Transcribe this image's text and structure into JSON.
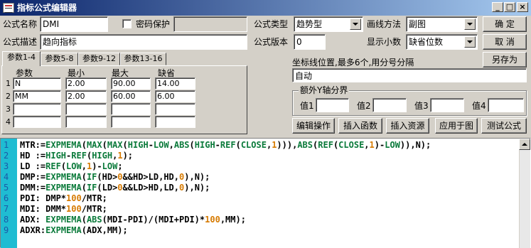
{
  "window": {
    "title": "指标公式编辑器",
    "minimize_label": "_",
    "maximize_label": "□",
    "close_label": "×"
  },
  "form": {
    "name_label": "公式名称",
    "name_value": "DMI",
    "password_label": "密码保护",
    "password_checked": false,
    "password_value": "",
    "type_label": "公式类型",
    "type_value": "趋势型",
    "draw_label": "画线方法",
    "draw_value": "副图",
    "desc_label": "公式描述",
    "desc_value": "趋向指标",
    "version_label": "公式版本",
    "version_value": "0",
    "decimals_label": "显示小数",
    "decimals_value": "缺省位数",
    "ok_label": "确  定",
    "cancel_label": "取  消",
    "saveas_label": "另存为"
  },
  "params": {
    "tabs": [
      "参数1-4",
      "参数5-8",
      "参数9-12",
      "参数13-16"
    ],
    "active_tab": 0,
    "headers": [
      "参数",
      "最小",
      "最大",
      "缺省"
    ],
    "rows": [
      {
        "num": "1",
        "name": "N",
        "min": "2.00",
        "max": "90.00",
        "def": "14.00"
      },
      {
        "num": "2",
        "name": "MM",
        "min": "2.00",
        "max": "60.00",
        "def": "6.00"
      },
      {
        "num": "3",
        "name": "",
        "min": "",
        "max": "",
        "def": ""
      },
      {
        "num": "4",
        "name": "",
        "min": "",
        "max": "",
        "def": ""
      }
    ]
  },
  "axis": {
    "label": "坐标线位置,最多6个,用分号分隔",
    "value": "自动",
    "extra_group_label": "额外Y轴分界",
    "values": [
      {
        "label": "值1",
        "value": ""
      },
      {
        "label": "值2",
        "value": ""
      },
      {
        "label": "值3",
        "value": ""
      },
      {
        "label": "值4",
        "value": ""
      }
    ]
  },
  "actions": {
    "edit": "编辑操作",
    "insert_func": "插入函数",
    "insert_res": "插入资源",
    "apply": "应用于图",
    "test": "测试公式"
  },
  "code_lines": [
    [
      [
        "t",
        "MTR:="
      ],
      [
        "f",
        "EXPMEMA"
      ],
      [
        "t",
        "("
      ],
      [
        "f",
        "MAX"
      ],
      [
        "t",
        "("
      ],
      [
        "f",
        "MAX"
      ],
      [
        "t",
        "("
      ],
      [
        "f",
        "HIGH"
      ],
      [
        "t",
        "-"
      ],
      [
        "f",
        "LOW"
      ],
      [
        "t",
        ","
      ],
      [
        "f",
        "ABS"
      ],
      [
        "t",
        "("
      ],
      [
        "f",
        "HIGH"
      ],
      [
        "t",
        "-"
      ],
      [
        "f",
        "REF"
      ],
      [
        "t",
        "("
      ],
      [
        "f",
        "CLOSE"
      ],
      [
        "t",
        ","
      ],
      [
        "n",
        "1"
      ],
      [
        "t",
        "))),"
      ],
      [
        "f",
        "ABS"
      ],
      [
        "t",
        "("
      ],
      [
        "f",
        "REF"
      ],
      [
        "t",
        "("
      ],
      [
        "f",
        "CLOSE"
      ],
      [
        "t",
        ","
      ],
      [
        "n",
        "1"
      ],
      [
        "t",
        ")-"
      ],
      [
        "f",
        "LOW"
      ],
      [
        "t",
        ")),N);"
      ]
    ],
    [
      [
        "t",
        "HD :="
      ],
      [
        "f",
        "HIGH"
      ],
      [
        "t",
        "-"
      ],
      [
        "f",
        "REF"
      ],
      [
        "t",
        "("
      ],
      [
        "f",
        "HIGH"
      ],
      [
        "t",
        ","
      ],
      [
        "n",
        "1"
      ],
      [
        "t",
        ");"
      ]
    ],
    [
      [
        "t",
        "LD :="
      ],
      [
        "f",
        "REF"
      ],
      [
        "t",
        "("
      ],
      [
        "f",
        "LOW"
      ],
      [
        "t",
        ","
      ],
      [
        "n",
        "1"
      ],
      [
        "t",
        ")-"
      ],
      [
        "f",
        "LOW"
      ],
      [
        "t",
        ";"
      ]
    ],
    [
      [
        "t",
        "DMP:="
      ],
      [
        "f",
        "EXPMEMA"
      ],
      [
        "t",
        "("
      ],
      [
        "f",
        "IF"
      ],
      [
        "t",
        "(HD>"
      ],
      [
        "n",
        "0"
      ],
      [
        "t",
        "&&HD>LD,HD,"
      ],
      [
        "n",
        "0"
      ],
      [
        "t",
        "),N);"
      ]
    ],
    [
      [
        "t",
        "DMM:="
      ],
      [
        "f",
        "EXPMEMA"
      ],
      [
        "t",
        "("
      ],
      [
        "f",
        "IF"
      ],
      [
        "t",
        "(LD>"
      ],
      [
        "n",
        "0"
      ],
      [
        "t",
        "&&LD>HD,LD,"
      ],
      [
        "n",
        "0"
      ],
      [
        "t",
        "),N);"
      ]
    ],
    [
      [
        "t",
        "PDI: DMP*"
      ],
      [
        "n",
        "100"
      ],
      [
        "t",
        "/MTR;"
      ]
    ],
    [
      [
        "t",
        "MDI: DMM*"
      ],
      [
        "n",
        "100"
      ],
      [
        "t",
        "/MTR;"
      ]
    ],
    [
      [
        "t",
        "ADX: "
      ],
      [
        "f",
        "EXPMEMA"
      ],
      [
        "t",
        "("
      ],
      [
        "f",
        "ABS"
      ],
      [
        "t",
        "(MDI-PDI)/(MDI+PDI)*"
      ],
      [
        "n",
        "100"
      ],
      [
        "t",
        ",MM);"
      ]
    ],
    [
      [
        "t",
        "ADXR:"
      ],
      [
        "f",
        "EXPMEMA"
      ],
      [
        "t",
        "(ADX,MM);"
      ]
    ]
  ],
  "colors": {
    "title_bar": "#0a246a",
    "gutter": "#1fbcd2",
    "function": "#0a7a3a",
    "number": "#d67a00"
  }
}
